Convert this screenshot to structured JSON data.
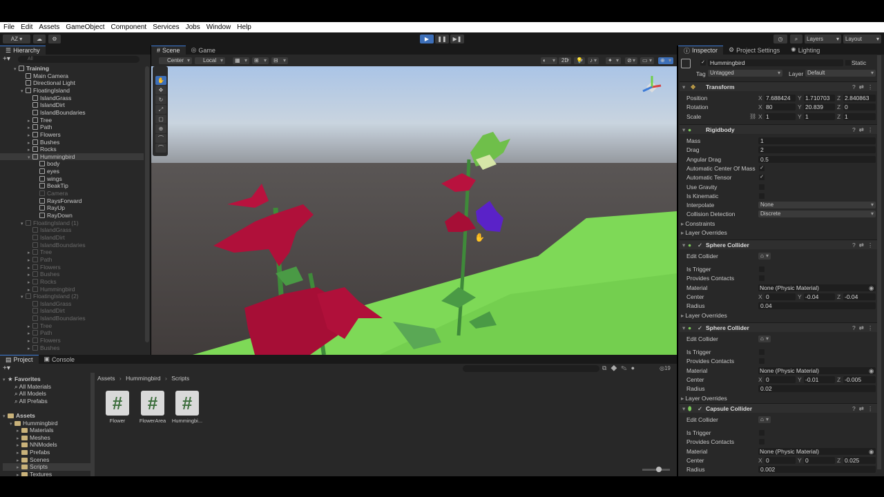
{
  "menu": [
    "File",
    "Edit",
    "Assets",
    "GameObject",
    "Component",
    "Services",
    "Jobs",
    "Window",
    "Help"
  ],
  "toolbar": {
    "account": "AZ ▾",
    "layers": "Layers",
    "layout": "Layout"
  },
  "hierarchy": {
    "tab": "Hierarchy",
    "search_placeholder": "All",
    "items": [
      {
        "label": "Training",
        "depth": 0,
        "dim": false,
        "bold": true
      },
      {
        "label": "Main Camera",
        "depth": 1,
        "dim": false
      },
      {
        "label": "Directional Light",
        "depth": 1,
        "dim": false
      },
      {
        "label": "FloatingIsland",
        "depth": 1,
        "dim": false
      },
      {
        "label": "IslandGrass",
        "depth": 2,
        "dim": false
      },
      {
        "label": "IslandDirt",
        "depth": 2,
        "dim": false
      },
      {
        "label": "IslandBoundaries",
        "depth": 2,
        "dim": false
      },
      {
        "label": "Tree",
        "depth": 2,
        "dim": false
      },
      {
        "label": "Path",
        "depth": 2,
        "dim": false
      },
      {
        "label": "Flowers",
        "depth": 2,
        "dim": false
      },
      {
        "label": "Bushes",
        "depth": 2,
        "dim": false
      },
      {
        "label": "Rocks",
        "depth": 2,
        "dim": false
      },
      {
        "label": "Hummingbird",
        "depth": 2,
        "dim": false,
        "selected": true
      },
      {
        "label": "body",
        "depth": 3,
        "dim": false
      },
      {
        "label": "eyes",
        "depth": 3,
        "dim": false
      },
      {
        "label": "wings",
        "depth": 3,
        "dim": false
      },
      {
        "label": "BeakTip",
        "depth": 3,
        "dim": false
      },
      {
        "label": "Camera",
        "depth": 3,
        "dim": true
      },
      {
        "label": "RaysForward",
        "depth": 3,
        "dim": false
      },
      {
        "label": "RayUp",
        "depth": 3,
        "dim": false
      },
      {
        "label": "RayDown",
        "depth": 3,
        "dim": false
      },
      {
        "label": "FloatingIsland (1)",
        "depth": 1,
        "dim": true
      },
      {
        "label": "IslandGrass",
        "depth": 2,
        "dim": true
      },
      {
        "label": "IslandDirt",
        "depth": 2,
        "dim": true
      },
      {
        "label": "IslandBoundaries",
        "depth": 2,
        "dim": true
      },
      {
        "label": "Tree",
        "depth": 2,
        "dim": true
      },
      {
        "label": "Path",
        "depth": 2,
        "dim": true
      },
      {
        "label": "Flowers",
        "depth": 2,
        "dim": true
      },
      {
        "label": "Bushes",
        "depth": 2,
        "dim": true
      },
      {
        "label": "Rocks",
        "depth": 2,
        "dim": true
      },
      {
        "label": "Hummingbird",
        "depth": 2,
        "dim": true
      },
      {
        "label": "FloatingIsland (2)",
        "depth": 1,
        "dim": true
      },
      {
        "label": "IslandGrass",
        "depth": 2,
        "dim": true
      },
      {
        "label": "IslandDirt",
        "depth": 2,
        "dim": true
      },
      {
        "label": "IslandBoundaries",
        "depth": 2,
        "dim": true
      },
      {
        "label": "Tree",
        "depth": 2,
        "dim": true
      },
      {
        "label": "Path",
        "depth": 2,
        "dim": true
      },
      {
        "label": "Flowers",
        "depth": 2,
        "dim": true
      },
      {
        "label": "Bushes",
        "depth": 2,
        "dim": true
      }
    ]
  },
  "scene": {
    "tab_scene": "Scene",
    "tab_game": "Game",
    "pivot": "Center",
    "space": "Local",
    "mode2d": "2D"
  },
  "project": {
    "tab_project": "Project",
    "tab_console": "Console",
    "breadcrumb": [
      "Assets",
      "Hummingbird",
      "Scripts"
    ],
    "count": "19",
    "tree": [
      {
        "label": "Favorites",
        "depth": 0,
        "bold": true,
        "icon": "star"
      },
      {
        "label": "All Materials",
        "depth": 1,
        "icon": "search"
      },
      {
        "label": "All Models",
        "depth": 1,
        "icon": "search"
      },
      {
        "label": "All Prefabs",
        "depth": 1,
        "icon": "search"
      },
      {
        "label": "",
        "depth": 0,
        "icon": "none"
      },
      {
        "label": "Assets",
        "depth": 0,
        "bold": true,
        "icon": "folder"
      },
      {
        "label": "Hummingbird",
        "depth": 1,
        "icon": "folder"
      },
      {
        "label": "Materials",
        "depth": 2,
        "icon": "folder"
      },
      {
        "label": "Meshes",
        "depth": 2,
        "icon": "folder"
      },
      {
        "label": "NNModels",
        "depth": 2,
        "icon": "folder"
      },
      {
        "label": "Prefabs",
        "depth": 2,
        "icon": "folder"
      },
      {
        "label": "Scenes",
        "depth": 2,
        "icon": "folder"
      },
      {
        "label": "Scripts",
        "depth": 2,
        "icon": "folder",
        "selected": true
      },
      {
        "label": "Textures",
        "depth": 2,
        "icon": "folder"
      }
    ],
    "assets": [
      "Flower",
      "FlowerArea",
      "Hummingbi..."
    ]
  },
  "inspector": {
    "tabs": [
      "Inspector",
      "Project Settings",
      "Lighting"
    ],
    "object_name": "Hummingbird",
    "static_label": "Static",
    "tag_label": "Tag",
    "tag_value": "Untagged",
    "layer_label": "Layer",
    "layer_value": "Default",
    "transform": {
      "title": "Transform",
      "position_label": "Position",
      "position": [
        "7.688424",
        "1.710703",
        "2.840863"
      ],
      "rotation_label": "Rotation",
      "rotation": [
        "80",
        "20.839",
        "0"
      ],
      "scale_label": "Scale",
      "scale": [
        "1",
        "1",
        "1"
      ]
    },
    "rigidbody": {
      "title": "Rigidbody",
      "mass_label": "Mass",
      "mass": "1",
      "drag_label": "Drag",
      "drag": "2",
      "angular_drag_label": "Angular Drag",
      "angular_drag": "0.5",
      "auto_com_label": "Automatic Center Of Mass",
      "auto_tensor_label": "Automatic Tensor",
      "use_gravity_label": "Use Gravity",
      "is_kinematic_label": "Is Kinematic",
      "interpolate_label": "Interpolate",
      "interpolate": "None",
      "collision_label": "Collision Detection",
      "collision": "Discrete",
      "constraints_label": "Constraints",
      "layer_overrides_label": "Layer Overrides"
    },
    "sphere1": {
      "title": "Sphere Collider",
      "edit_label": "Edit Collider",
      "trigger_label": "Is Trigger",
      "contacts_label": "Provides Contacts",
      "material_label": "Material",
      "material": "None (Physic Material)",
      "center_label": "Center",
      "center": [
        "0",
        "-0.04",
        "-0.04"
      ],
      "radius_label": "Radius",
      "radius": "0.04",
      "layer_overrides_label": "Layer Overrides"
    },
    "sphere2": {
      "title": "Sphere Collider",
      "edit_label": "Edit Collider",
      "trigger_label": "Is Trigger",
      "contacts_label": "Provides Contacts",
      "material_label": "Material",
      "material": "None (Physic Material)",
      "center_label": "Center",
      "center": [
        "0",
        "-0.01",
        "-0.005"
      ],
      "radius_label": "Radius",
      "radius": "0.02",
      "layer_overrides_label": "Layer Overrides"
    },
    "capsule": {
      "title": "Capsule Collider",
      "edit_label": "Edit Collider",
      "trigger_label": "Is Trigger",
      "contacts_label": "Provides Contacts",
      "material_label": "Material",
      "material": "None (Physic Material)",
      "center_label": "Center",
      "center": [
        "0",
        "0",
        "0.025"
      ],
      "radius_label": "Radius",
      "radius": "0.002"
    },
    "axis_labels": [
      "X",
      "Y",
      "Z"
    ]
  },
  "colors": {
    "panel": "#282828",
    "dark": "#191919",
    "accent": "#3d7bd6",
    "grass": "#7ed957",
    "flower_red": "#b0103a",
    "flower_purple": "#5a22c8"
  }
}
